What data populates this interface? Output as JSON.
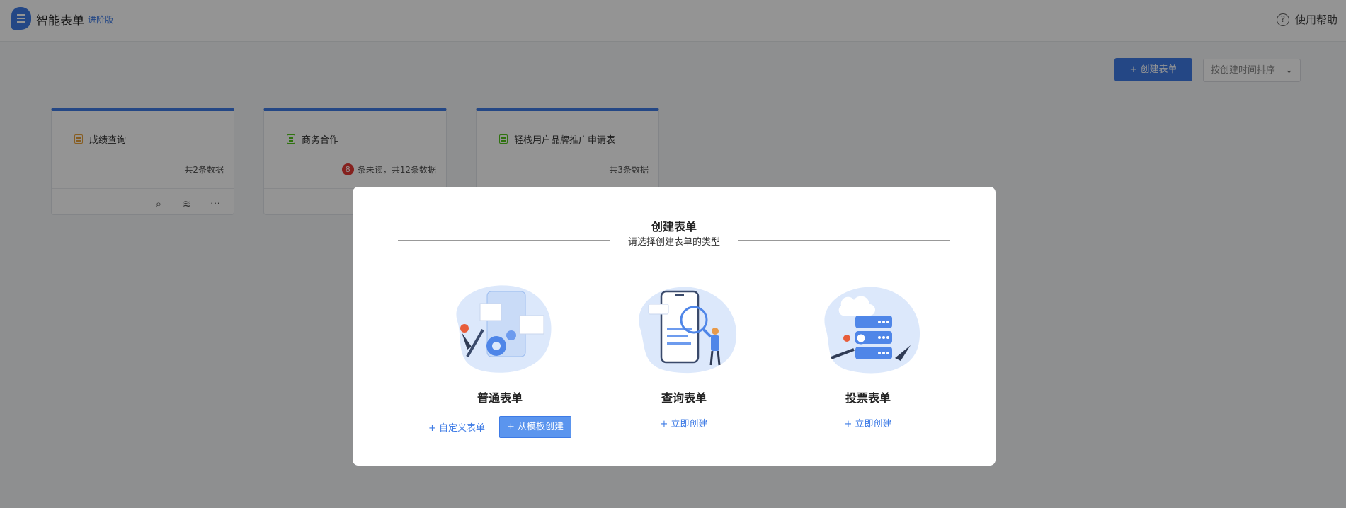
{
  "header": {
    "app_title": "智能表单",
    "edition": "进阶版",
    "help_label": "使用帮助",
    "help_icon_glyph": "?"
  },
  "toolbar": {
    "create_label": "+ 创建表单",
    "sort_value": "按创建时间排序",
    "sort_arrow": "⌄"
  },
  "cards": [
    {
      "title": "成绩查询",
      "count_text": "共2条数据",
      "icon": "form-icon-orange"
    },
    {
      "title": "商务合作",
      "unread": "8",
      "count_text": "条未读，共12条数据",
      "icon": "form-icon-green"
    },
    {
      "title": "轻栈用户品牌推广申请表",
      "count_text": "共3条数据",
      "icon": "form-icon-green"
    }
  ],
  "card_actions": {
    "preview_glyph": "⌕",
    "layers_glyph": "≋",
    "more_glyph": "···"
  },
  "modal": {
    "title": "创建表单",
    "subtitle": "请选择创建表单的类型",
    "types": [
      {
        "name": "普通表单",
        "action_link": "+ 自定义表单",
        "action_primary": "+ 从模板创建",
        "illustration": "gear-tools-illustration"
      },
      {
        "name": "查询表单",
        "action_link": "+ 立即创建",
        "illustration": "phone-search-illustration"
      },
      {
        "name": "投票表单",
        "action_link": "+ 立即创建",
        "illustration": "server-cloud-illustration"
      }
    ]
  },
  "colors": {
    "accent": "#3e7be6",
    "badge": "#e53935",
    "illustration_bg": "#dce8fb"
  }
}
